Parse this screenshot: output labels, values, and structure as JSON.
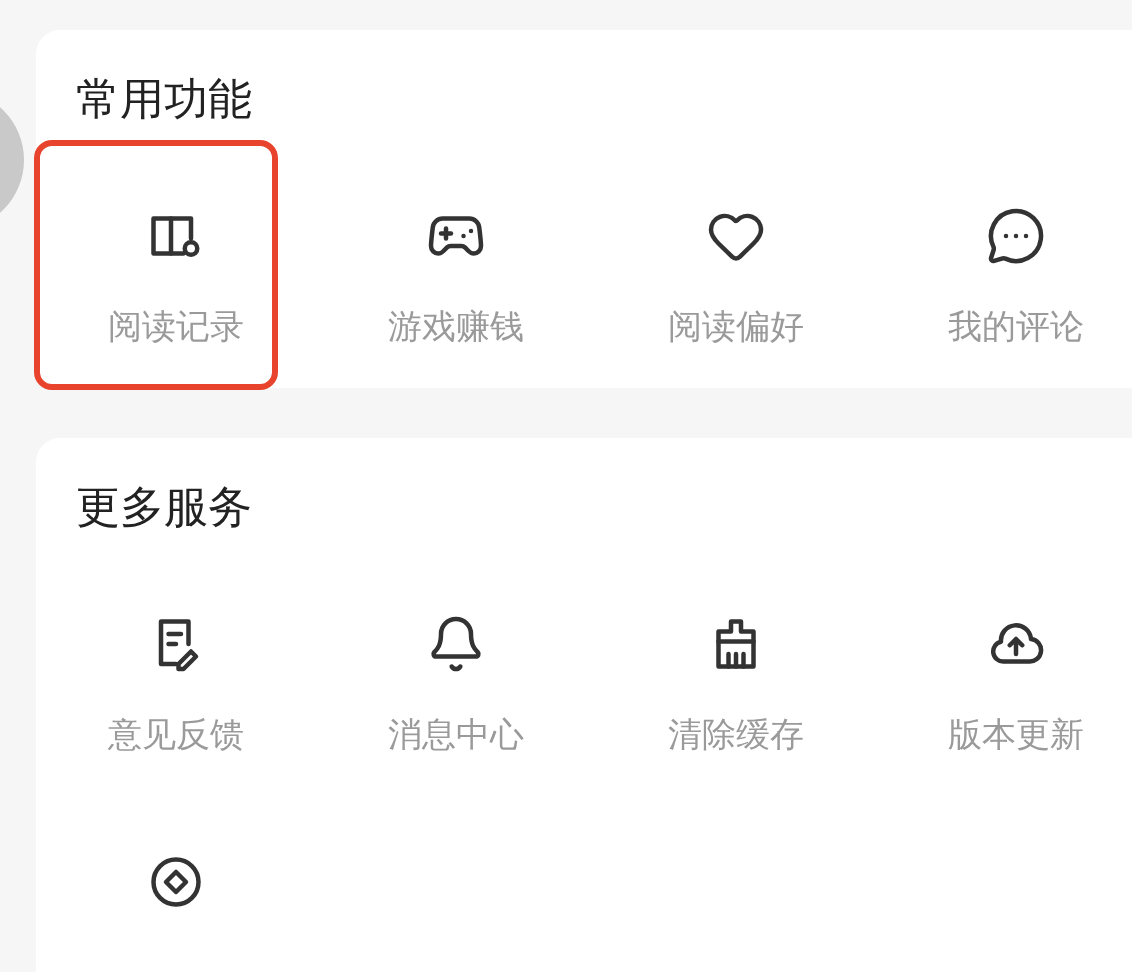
{
  "sections": [
    {
      "title": "常用功能",
      "items": [
        {
          "label": "阅读记录",
          "highlighted": true
        },
        {
          "label": "游戏赚钱",
          "highlighted": false
        },
        {
          "label": "阅读偏好",
          "highlighted": false
        },
        {
          "label": "我的评论",
          "highlighted": false
        }
      ]
    },
    {
      "title": "更多服务",
      "items": [
        {
          "label": "意见反馈",
          "highlighted": false
        },
        {
          "label": "消息中心",
          "highlighted": false
        },
        {
          "label": "清除缓存",
          "highlighted": false
        },
        {
          "label": "版本更新",
          "highlighted": false
        },
        {
          "highlighted": false
        }
      ]
    }
  ]
}
